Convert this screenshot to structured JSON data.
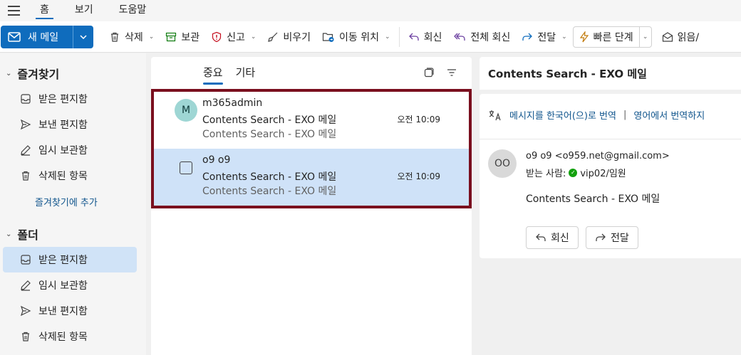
{
  "menu": {
    "tabs": [
      "홈",
      "보기",
      "도움말"
    ]
  },
  "ribbon": {
    "new_mail": "새 메일",
    "delete": "삭제",
    "archive": "보관",
    "report": "신고",
    "sweep": "비우기",
    "move": "이동 위치",
    "reply": "회신",
    "reply_all": "전체 회신",
    "forward": "전달",
    "quick_steps": "빠른 단계",
    "read_unread": "읽음/"
  },
  "sidebar": {
    "favorites_title": "즐겨찾기",
    "favorites": [
      "받은 편지함",
      "보낸 편지함",
      "임시 보관함",
      "삭제된 항목"
    ],
    "add_favorite": "즐겨찾기에 추가",
    "folders_title": "폴더",
    "folders": [
      "받은 편지함",
      "임시 보관함",
      "보낸 편지함",
      "삭제된 항목"
    ]
  },
  "list": {
    "tabs": [
      "중요",
      "기타"
    ],
    "messages": [
      {
        "avatar": "M",
        "sender": "m365admin",
        "subject": "Contents Search - EXO 메일",
        "preview": "Contents Search - EXO 메일",
        "time": "오전 10:09"
      },
      {
        "sender": "o9 o9",
        "subject": "Contents Search - EXO 메일",
        "preview": "Contents Search - EXO 메일",
        "time": "오전 10:09"
      }
    ]
  },
  "reading": {
    "title": "Contents Search - EXO 메일",
    "translate": "메시지를 한국어(으)로 번역",
    "separator": "|",
    "no_translate": "영어에서 번역하지",
    "avatar": "OO",
    "from": "o9 o9 <o959.net@gmail.com>",
    "to_label": "받는 사람:",
    "to": "vip02/임원",
    "body": "Contents Search - EXO 메일",
    "reply": "회신",
    "forward": "전달"
  },
  "colors": {
    "accent": "#0f6cbd",
    "selected": "#cfe2f8",
    "highlight_border": "#7a0f1e"
  }
}
